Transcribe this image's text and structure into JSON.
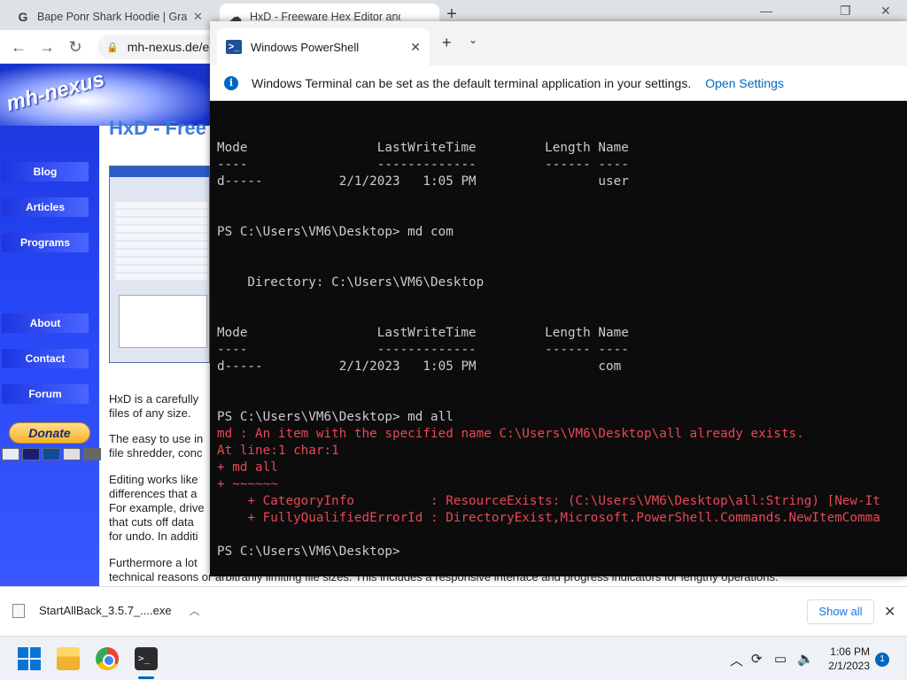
{
  "chrome": {
    "tabs": [
      {
        "favicon": "G",
        "title": "Bape Ponr Shark Hoodie | Grailed"
      },
      {
        "favicon": "hxd-icon",
        "title": "HxD - Freeware Hex Editor and D"
      }
    ],
    "new_tab": "+",
    "address": "mh-nexus.de/er"
  },
  "webpage": {
    "logo": "mh-nexus",
    "title": "HxD - Free",
    "nav": [
      "Blog",
      "Articles",
      "Programs",
      "About",
      "Contact",
      "Forum"
    ],
    "donate": "Donate",
    "paragraphs": [
      "HxD is a carefully",
      "files of any size.",
      "The easy to use in",
      "file shredder, conc",
      "Editing works like",
      "differences that a",
      "For example, drive",
      "that cuts off data",
      "for undo. In additi",
      "Furthermore a lot",
      "technical reasons or arbitrarily limiting file sizes. This includes a responsive interface and progress indicators for lengthy operations."
    ]
  },
  "terminal": {
    "tab_title": "Windows PowerShell",
    "info_message": "Windows Terminal can be set as the default terminal application in your settings.",
    "info_link": "Open Settings",
    "lines": [
      {
        "text": "Mode                 LastWriteTime         Length Name",
        "err": false
      },
      {
        "text": "----                 -------------         ------ ----",
        "err": false
      },
      {
        "text": "d-----          2/1/2023   1:05 PM                user",
        "err": false
      },
      {
        "text": "",
        "err": false
      },
      {
        "text": "",
        "err": false
      },
      {
        "text": "PS C:\\Users\\VM6\\Desktop> md com",
        "err": false
      },
      {
        "text": "",
        "err": false
      },
      {
        "text": "",
        "err": false
      },
      {
        "text": "    Directory: C:\\Users\\VM6\\Desktop",
        "err": false
      },
      {
        "text": "",
        "err": false
      },
      {
        "text": "",
        "err": false
      },
      {
        "text": "Mode                 LastWriteTime         Length Name",
        "err": false
      },
      {
        "text": "----                 -------------         ------ ----",
        "err": false
      },
      {
        "text": "d-----          2/1/2023   1:05 PM                com",
        "err": false
      },
      {
        "text": "",
        "err": false
      },
      {
        "text": "",
        "err": false
      },
      {
        "text": "PS C:\\Users\\VM6\\Desktop> md all",
        "err": false
      },
      {
        "text": "md : An item with the specified name C:\\Users\\VM6\\Desktop\\all already exists.",
        "err": true
      },
      {
        "text": "At line:1 char:1",
        "err": true
      },
      {
        "text": "+ md all",
        "err": true
      },
      {
        "text": "+ ~~~~~~",
        "err": true
      },
      {
        "text": "    + CategoryInfo          : ResourceExists: (C:\\Users\\VM6\\Desktop\\all:String) [New-It",
        "err": true
      },
      {
        "text": "    + FullyQualifiedErrorId : DirectoryExist,Microsoft.PowerShell.Commands.NewItemComma",
        "err": true
      },
      {
        "text": "",
        "err": false
      },
      {
        "text": "PS C:\\Users\\VM6\\Desktop>",
        "err": false
      }
    ]
  },
  "downloads": {
    "file": "StartAllBack_3.5.7_....exe",
    "show_all": "Show all"
  },
  "taskbar": {
    "time": "1:06 PM",
    "date": "2/1/2023",
    "notifications": "1"
  },
  "colors": {
    "error": "#e74856",
    "accent": "#0067c0",
    "terminal_bg": "#0c0c0c"
  }
}
